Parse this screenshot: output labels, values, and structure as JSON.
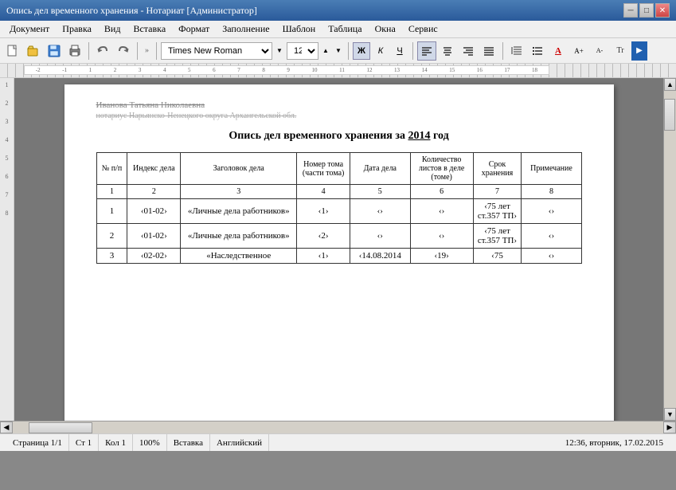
{
  "window": {
    "title": "Опись дел временного хранения - Нотариат [Администратор]",
    "controls": {
      "minimize": "─",
      "maximize": "□",
      "close": "✕"
    }
  },
  "menu": {
    "items": [
      "Документ",
      "Правка",
      "Вид",
      "Вставка",
      "Формат",
      "Заполнение",
      "Шаблон",
      "Таблица",
      "Окна",
      "Сервис"
    ]
  },
  "toolbar": {
    "font": "Times New Roman",
    "font_size": "12",
    "bold": "Ж",
    "italic": "К",
    "underline": "Ч"
  },
  "doc": {
    "title": "Опись дел временного хранения за ",
    "year": "2014",
    "title_end": " год",
    "header_line1": "Иванова Татьяна Николаевна",
    "header_line2": "нотариус Нарьянско-Ненецкого округа Архангельской обл.",
    "table": {
      "headers": [
        "№ п/п",
        "Индекс дела",
        "Заголовок дела",
        "Номер тома (части тома)",
        "Дата дела",
        "Количество листов в деле (томе)",
        "Срок хранения",
        "Примечание"
      ],
      "num_row": [
        "1",
        "2",
        "3",
        "4",
        "5",
        "6",
        "7",
        "8"
      ],
      "rows": [
        {
          "num": "1",
          "index": "‹01-02›",
          "title": "«Личные дела работников»",
          "vol": "‹1›",
          "date": "‹›",
          "sheets": "‹›",
          "period": "‹75 лет ст.357 ТП›",
          "note": "‹›"
        },
        {
          "num": "2",
          "index": "‹01-02›",
          "title": "«Личные дела работников»",
          "vol": "‹2›",
          "date": "‹›",
          "sheets": "‹›",
          "period": "‹75 лет ст.357 ТП›",
          "note": "‹›"
        },
        {
          "num": "3",
          "index": "‹02-02›",
          "title": "«Наследственное",
          "vol": "‹1›",
          "date": "‹14.08.2014",
          "sheets": "‹19›",
          "period": "‹75",
          "note": "‹›"
        }
      ]
    }
  },
  "status": {
    "page": "Страница 1/1",
    "st": "Ст 1",
    "col": "Кол 1",
    "zoom": "100%",
    "mode": "Вставка",
    "language": "Английский",
    "time": "12:36, вторник, 17.02.2015"
  }
}
